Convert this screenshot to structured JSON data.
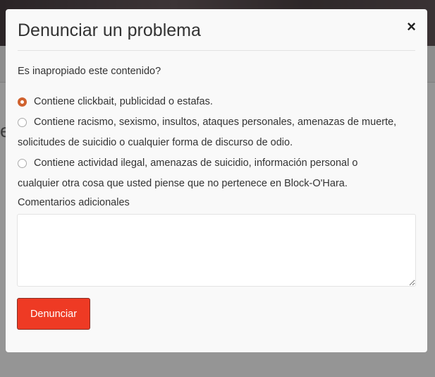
{
  "modal": {
    "title": "Denunciar un problema",
    "close_icon": "×",
    "question": "Es inapropiado este contenido?",
    "options": [
      {
        "label": "Contiene clickbait, publicidad o estafas.",
        "selected": true
      },
      {
        "label": "Contiene racismo, sexismo, insultos, ataques personales, amenazas de muerte, solicitudes de suicidio o cualquier forma de discurso de odio.",
        "selected": false
      },
      {
        "label": "Contiene actividad ilegal, amenazas de suicidio, información personal o cualquier otra cosa que usted piense que no pertenece en Block-O'Hara.",
        "selected": false
      }
    ],
    "comments_label": "Comentarios adicionales",
    "comments_value": "",
    "submit_label": "Denunciar",
    "accent_color": "#ee3a24"
  }
}
